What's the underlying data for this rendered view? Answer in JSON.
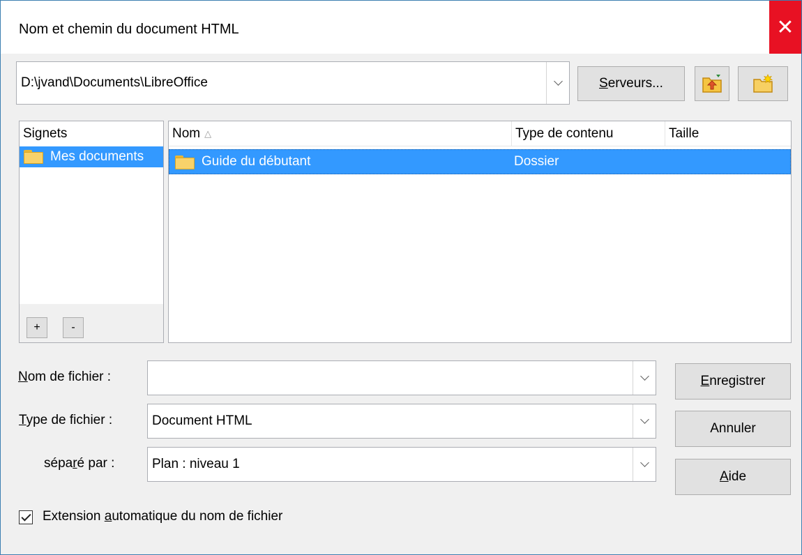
{
  "title": "Nom et chemin du document HTML",
  "close_glyph": "✕",
  "path": "D:\\jvand\\Documents\\LibreOffice",
  "servers_button": {
    "u": "S",
    "rest": "erveurs..."
  },
  "bookmarks": {
    "header": "Signets",
    "items": [
      "Mes documents"
    ],
    "add_label": "+",
    "remove_label": "-"
  },
  "files": {
    "columns": {
      "name": "Nom",
      "sort_glyph": "△",
      "type": "Type de contenu",
      "size": "Taille"
    },
    "rows": [
      {
        "name": "Guide du débutant",
        "type": "Dossier",
        "size": ""
      }
    ]
  },
  "filename": {
    "label_u": "N",
    "label_rest": "om de fichier :",
    "value": ""
  },
  "filetype": {
    "label_u": "T",
    "label_rest": "ype de fichier :",
    "value": "Document HTML"
  },
  "separated": {
    "label_pre": "sépa",
    "label_u": "r",
    "label_post": "é par :",
    "value": "Plan : niveau 1"
  },
  "buttons": {
    "save": {
      "u": "E",
      "rest": "nregistrer"
    },
    "cancel": "Annuler",
    "help": {
      "u": "A",
      "rest": "ide"
    }
  },
  "auto_ext": {
    "pre": "Extension ",
    "u": "a",
    "post": "utomatique du nom de fichier",
    "checked": true
  },
  "colors": {
    "selection": "#3399ff",
    "close": "#e81123"
  }
}
